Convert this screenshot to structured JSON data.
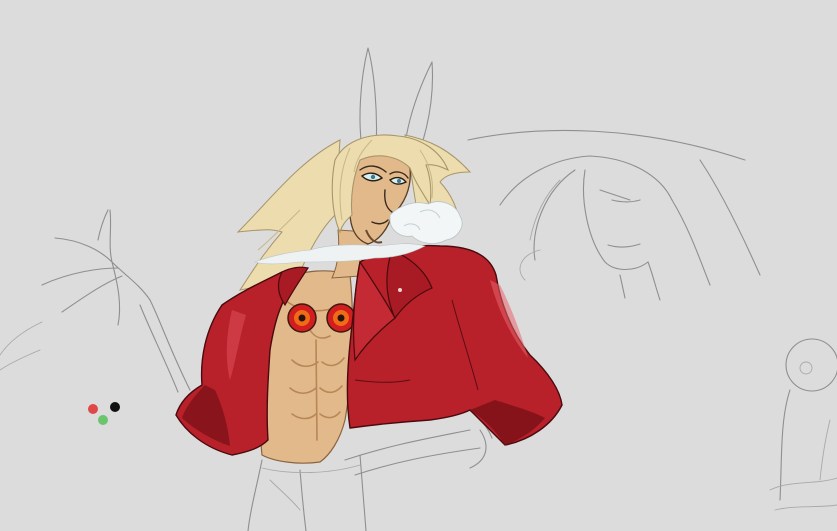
{
  "canvas": {
    "background": "#dcdcdc"
  },
  "colors": {
    "jacket": "#b8202a",
    "jacket_shadow": "#7e1218",
    "jacket_highlight": "#e0505a",
    "hair": "#ecdcae",
    "hair_shadow": "#c9b784",
    "skin": "#e2b98a",
    "skin_shadow": "#bf8d60",
    "eye_orange": "#e05a18",
    "eye_red": "#c81a1a",
    "smoke": "#f2f6f7",
    "sketch_line": "#8f8f8f"
  },
  "swatches": [
    {
      "name": "red",
      "color": "#e04848"
    },
    {
      "name": "black",
      "color": "#111111"
    },
    {
      "name": "green",
      "color": "#6cc46c"
    }
  ]
}
